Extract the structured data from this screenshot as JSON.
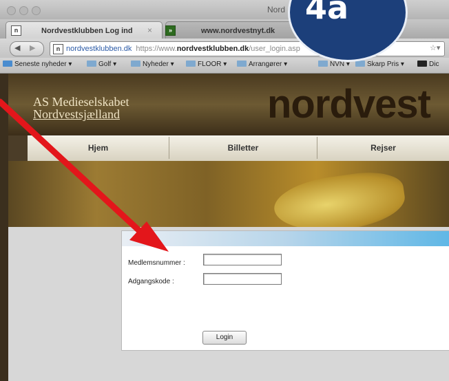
{
  "window": {
    "title": "Nord"
  },
  "tabs": [
    {
      "label": "Nordvestklubben Log ind",
      "favicon": "n",
      "close": "×"
    },
    {
      "label": "www.nordvestnyt.dk",
      "favicon": "»"
    }
  ],
  "address": {
    "domain": "nordvestklubben.dk",
    "url_prefix": "https://www.",
    "url_host": "nordvestklubben.dk",
    "url_path": "/user_login.asp"
  },
  "bookmarks": [
    {
      "label": "Seneste nyheder ▾"
    },
    {
      "label": "Golf ▾"
    },
    {
      "label": "Nyheder ▾"
    },
    {
      "label": "FLOOR ▾"
    },
    {
      "label": "Arrangører ▾"
    },
    {
      "label": "NVN ▾"
    },
    {
      "label": "Skarp Pris ▾"
    },
    {
      "label": "Dic"
    }
  ],
  "site": {
    "logo_line1": "AS Medieselskabet",
    "logo_line2": "Nordvestsjælland",
    "brand": "nordvest"
  },
  "nav": [
    {
      "label": "Hjem"
    },
    {
      "label": "Billetter"
    },
    {
      "label": "Rejser"
    }
  ],
  "login": {
    "member_label": "Medlemsnummer :",
    "member_value": "",
    "password_label": "Adgangskode :",
    "password_value": "",
    "button": "Login"
  },
  "annotation": {
    "badge": "4a",
    "badge_color": "#1c3f7a",
    "arrow_color": "#e3161b"
  }
}
